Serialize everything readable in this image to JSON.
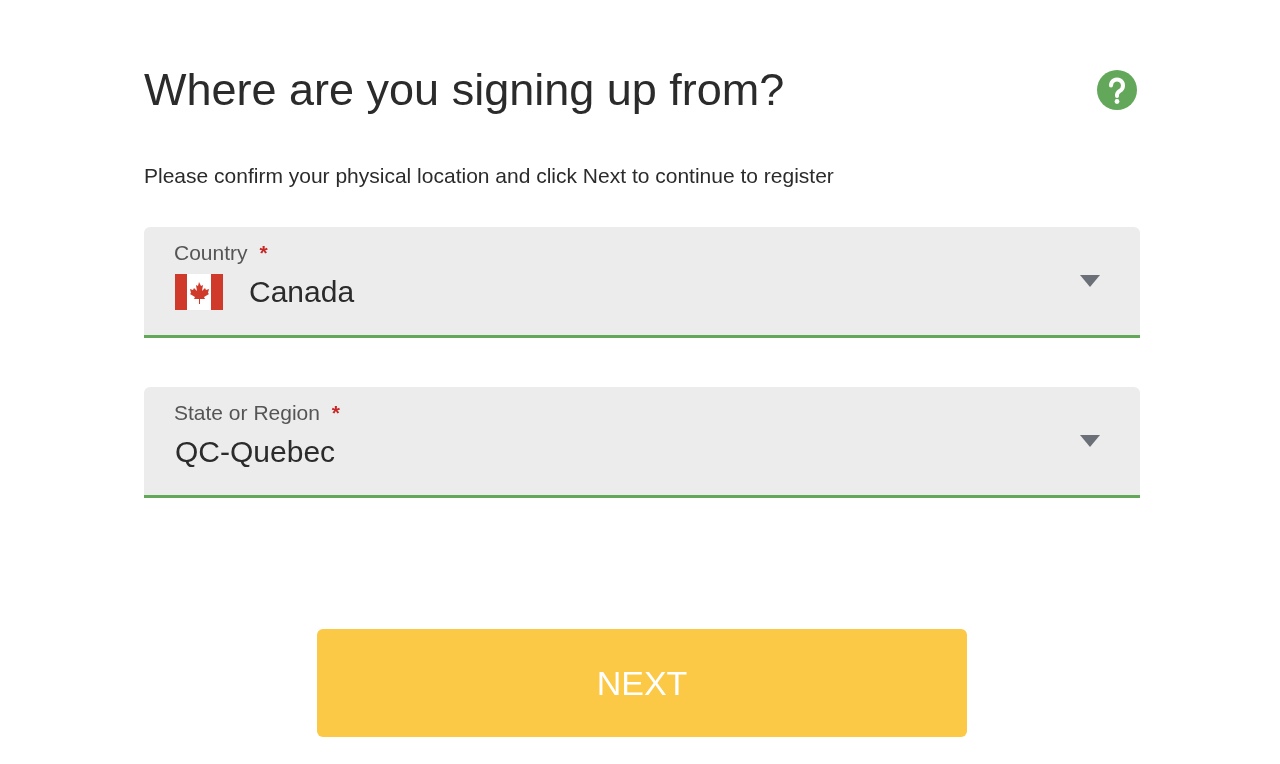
{
  "title": "Where are you signing up from?",
  "instructions": "Please confirm your physical location and click Next to continue to register",
  "fields": [
    {
      "kind": "country",
      "label": "Country",
      "required_mark": "*",
      "value": "Canada"
    },
    {
      "kind": "plain",
      "label": "State or Region",
      "required_mark": "*",
      "value": "QC-Quebec"
    }
  ],
  "button": "NEXT"
}
